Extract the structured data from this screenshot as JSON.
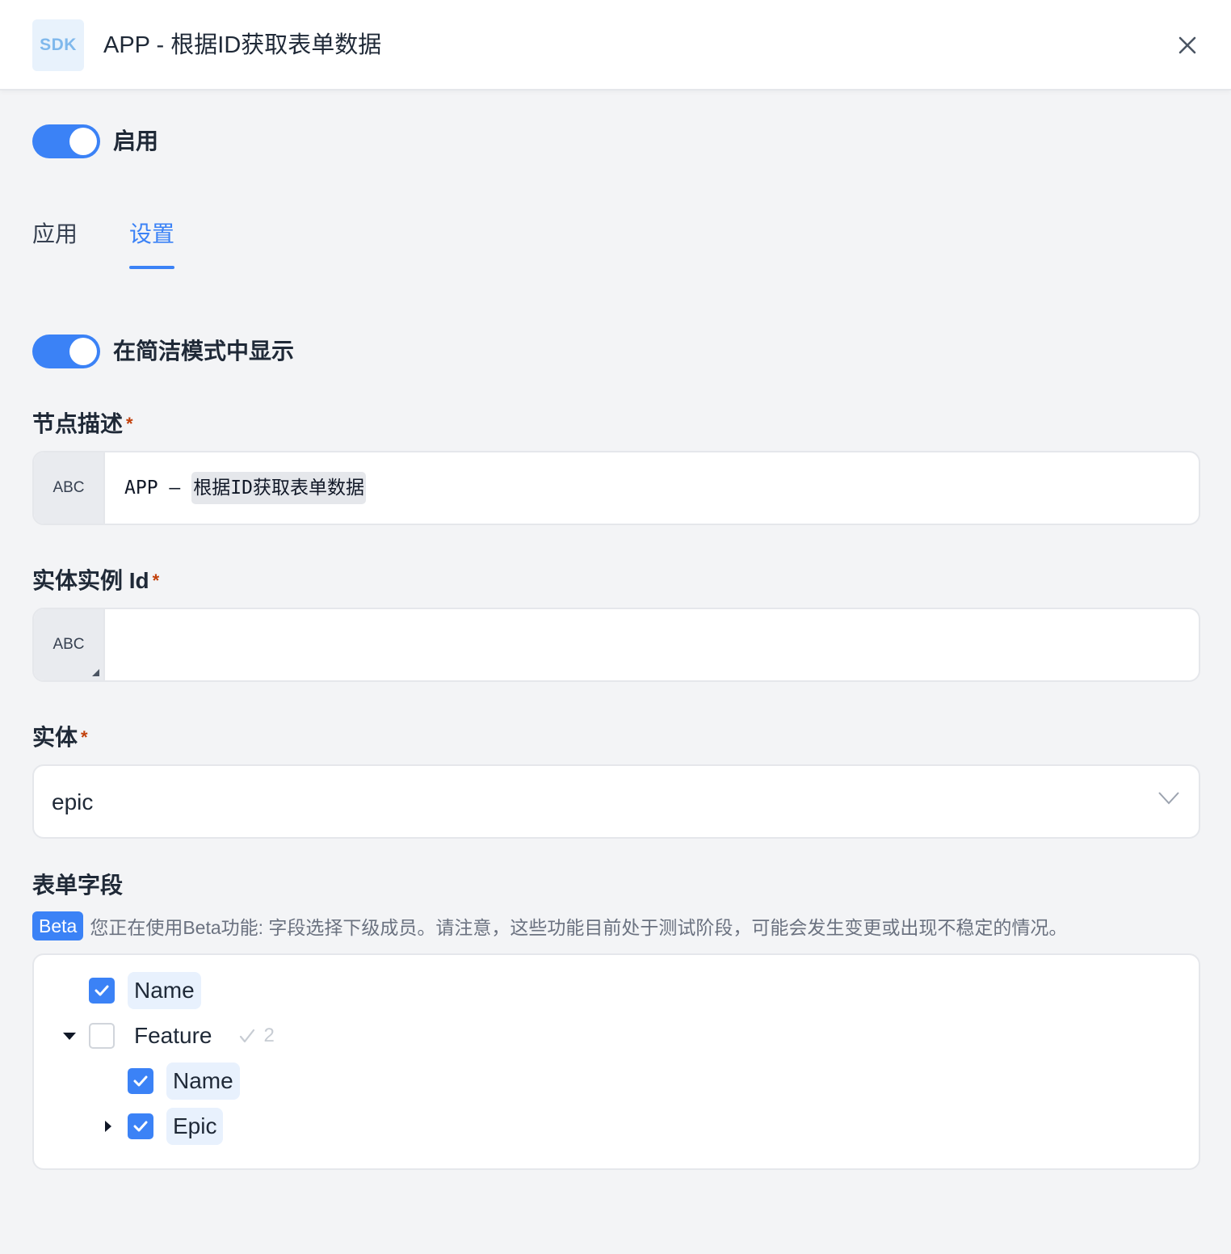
{
  "header": {
    "logo_text": "SDK",
    "title": "APP - 根据ID获取表单数据",
    "close_icon": "close-icon"
  },
  "enable_toggle": {
    "label": "启用",
    "on": true
  },
  "tabs": [
    {
      "label": "应用",
      "active": false
    },
    {
      "label": "设置",
      "active": true
    }
  ],
  "simple_mode_toggle": {
    "label": "在简洁模式中显示",
    "on": true
  },
  "fields": {
    "node_description": {
      "label": "节点描述",
      "required_mark": "*",
      "prefix": "ABC",
      "value_prefix": "APP –",
      "value_highlight": "根据ID获取表单数据"
    },
    "entity_instance_id": {
      "label": "实体实例 Id",
      "required_mark": "*",
      "prefix": "ABC",
      "value": ""
    },
    "entity": {
      "label": "实体",
      "required_mark": "*",
      "value": "epic"
    }
  },
  "form_fields": {
    "label": "表单字段",
    "beta_badge": "Beta",
    "beta_notice": "您正在使用Beta功能: 字段选择下级成员。请注意，这些功能目前处于测试阶段，可能会发生变更或出现不稳定的情况。",
    "tree": [
      {
        "label": "Name",
        "checked": true
      },
      {
        "label": "Feature",
        "checked": false,
        "expanded": true,
        "selected_count": "2"
      },
      {
        "label": "Name",
        "checked": true
      },
      {
        "label": "Epic",
        "checked": true,
        "expanded": false
      }
    ]
  },
  "colors": {
    "accent": "#3b82f6",
    "required": "#c2410c",
    "background": "#f3f4f6"
  }
}
